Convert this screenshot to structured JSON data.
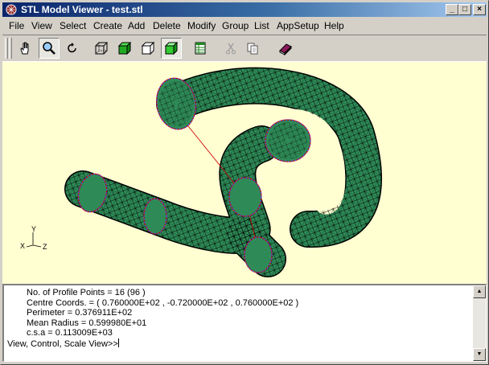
{
  "window": {
    "title": "STL Model Viewer - test.stl",
    "controls": {
      "minimize": "_",
      "maximize": "□",
      "close": "×"
    }
  },
  "menu": [
    "File",
    "View",
    "Select",
    "Create",
    "Add",
    "Delete",
    "Modify",
    "Group",
    "List",
    "AppSetup",
    "Help"
  ],
  "toolbar": {
    "tools": [
      {
        "icon": "hand-pan-icon",
        "pressed": false
      },
      {
        "icon": "magnifier-zoom-icon",
        "pressed": true
      },
      {
        "icon": "rotate-icon",
        "pressed": false
      },
      {
        "icon": "wireframe-cube-icon",
        "pressed": false
      },
      {
        "icon": "shaded-cube-icon",
        "pressed": false
      },
      {
        "icon": "hidden-line-cube-icon",
        "pressed": false
      },
      {
        "icon": "solid-cube-icon",
        "pressed": true
      },
      {
        "icon": "spreadsheet-icon",
        "pressed": false
      },
      {
        "icon": "cut-icon",
        "pressed": false
      },
      {
        "icon": "copy-icon",
        "pressed": false
      },
      {
        "icon": "book-help-icon",
        "pressed": false
      }
    ]
  },
  "viewport": {
    "background": "#ffffd2",
    "model_color": "#2e8b57",
    "axes": {
      "x": "X",
      "y": "Y",
      "z": "Z"
    }
  },
  "console": {
    "lines": [
      "No. of Profile Points = 16 (96 )",
      "Centre Coords. = ( 0.760000E+02 , -0.720000E+02 ,  0.760000E+02 )",
      "Perimeter =  0.376911E+02",
      "Mean Radius =  0.599980E+01",
      "c.s.a =  0.113009E+03"
    ],
    "prompt": "View, Control, Scale View>>"
  }
}
